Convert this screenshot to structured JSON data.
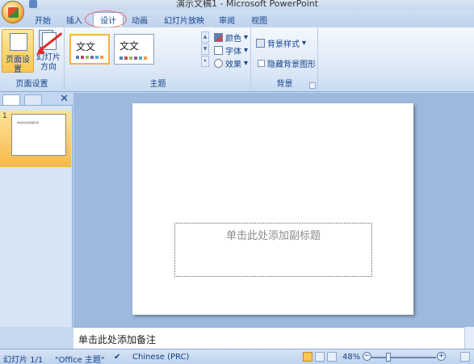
{
  "window": {
    "title": "演示文稿1 - Microsoft PowerPoint"
  },
  "tabs": [
    {
      "label": "开始"
    },
    {
      "label": "插入"
    },
    {
      "label": "设计"
    },
    {
      "label": "动画"
    },
    {
      "label": "幻灯片放映"
    },
    {
      "label": "审阅"
    },
    {
      "label": "视图"
    }
  ],
  "ribbon": {
    "page_setup_group": {
      "page_setup_label": "页面设置",
      "orientation_label_1": "幻灯片",
      "orientation_label_2": "方向",
      "group_label": "页面设置"
    },
    "themes_group": {
      "themes": [
        {
          "text": "文文"
        },
        {
          "text": "文文"
        }
      ],
      "colors_label": "颜色",
      "fonts_label": "字体",
      "effects_label": "效果",
      "group_label": "主题"
    },
    "background_group": {
      "background_styles_label": "背景样式",
      "hide_background_label": "隐藏背景图形",
      "group_label": "背景"
    }
  },
  "slides_panel": {
    "slide_number": "1",
    "thumb_text": "单击此处添加副标题"
  },
  "slide": {
    "subtitle_placeholder": "单击此处添加副标题"
  },
  "notes": {
    "placeholder": "单击此处添加备注"
  },
  "status": {
    "slide_counter": "幻灯片 1/1",
    "theme_name": "\"Office 主题\"",
    "language": "Chinese (PRC)",
    "zoom": "48%"
  },
  "colors": {
    "accent_orange": "#f9c64e",
    "annotation_red": "#e02a2a"
  }
}
